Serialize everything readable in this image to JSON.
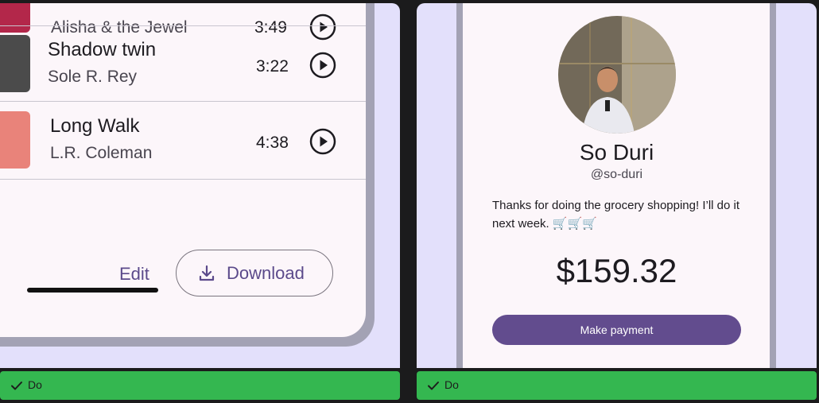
{
  "left_example": {
    "tracks": [
      {
        "title": "",
        "artist": "Alisha & the Jewel",
        "duration": "3:49",
        "art_color": "#b3274a"
      },
      {
        "title": "Shadow twin",
        "artist": "Sole R. Rey",
        "duration": "3:22",
        "art_color": "#4b4b4b"
      },
      {
        "title": "Long Walk",
        "artist": "L.R. Coleman",
        "duration": "4:38",
        "art_color": "#e9837a"
      }
    ],
    "actions": {
      "edit": "Edit",
      "download": "Download"
    },
    "banner": {
      "label": "Do"
    }
  },
  "right_example": {
    "profile": {
      "name": "So Duri",
      "handle": "@so-duri"
    },
    "message": "Thanks for doing the grocery shopping! I’ll do it next week. 🛒🛒🛒",
    "amount": "$159.32",
    "pay_button": "Make payment",
    "banner": {
      "label": "Do"
    }
  },
  "colors": {
    "background": "#1b1b1c",
    "panel": "#e3e0fb",
    "screen": "#fcf6fa",
    "frame": "#a3a2b4",
    "accent": "#624c8e",
    "banner": "#34b750"
  }
}
